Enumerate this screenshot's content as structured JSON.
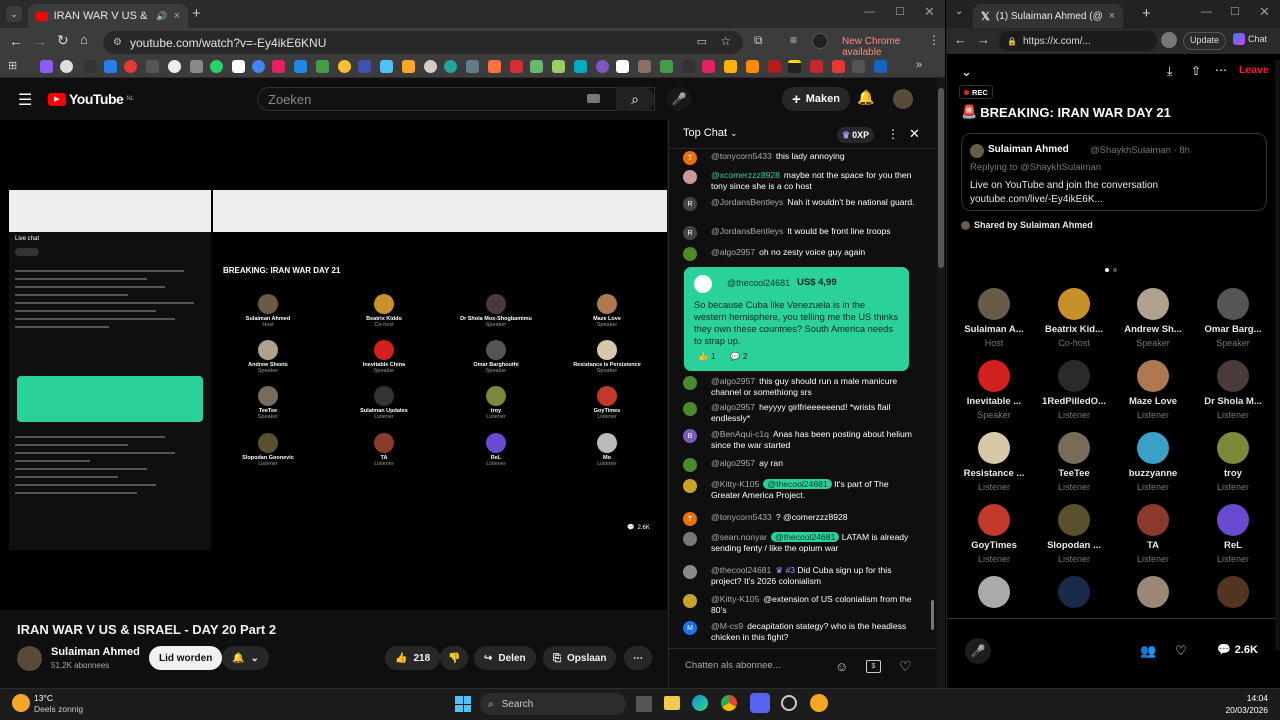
{
  "left_browser": {
    "tab_title": "IRAN WAR V US & ISRAEL",
    "url": "youtube.com/watch?v=-Ey4ikE6KNU",
    "update_label": "New Chrome available"
  },
  "youtube": {
    "logo_text": "YouTube",
    "logo_region": "NL",
    "search_placeholder": "Zoeken",
    "create_label": "Maken",
    "video_title": "IRAN WAR V US & ISRAEL - DAY 20 Part 2",
    "channel_name": "Sulaiman Ahmed",
    "subscribers": "51,2K abonnees",
    "join_label": "Lid worden",
    "likes": "218",
    "share_label": "Delen",
    "save_label": "Opslaan"
  },
  "chat": {
    "title": "Top Chat",
    "xp": "0XP",
    "input_placeholder": "Chatten als abonnee...",
    "messages": [
      {
        "user": "@tonycorn5433",
        "text": "this lady annoying",
        "initial": "T",
        "color": "#e8710a"
      },
      {
        "user": "@xcomerzzz8928",
        "text": "maybe not the space for you then tony since she is a co host",
        "initial": "",
        "color": "#c99",
        "highlight": true
      },
      {
        "user": "@JordansBentleys",
        "text": "Nah it wouldn't be national guard.",
        "initial": "R",
        "color": "#444"
      },
      {
        "user": "@JordansBentleys",
        "text": "It would be front line troops",
        "initial": "R",
        "color": "#444"
      },
      {
        "user": "@algo2957",
        "text": "oh no zesty voice guy again",
        "initial": "",
        "color": "#4a8a2a"
      }
    ],
    "superchat": {
      "user": "@thecool24681",
      "amount": "US$ 4,99",
      "text": "So because Cuba like Venezuela is in the western hemisphere, you telling me the US thinks they own these countries? South America needs to strap up.",
      "likes": "1",
      "replies": "2"
    },
    "messages2": [
      {
        "user": "@algo2957",
        "text": "this guy should run a male manicure channel or somethiong srs",
        "initial": "",
        "color": "#4a8a2a"
      },
      {
        "user": "@algo2957",
        "text": "heyyyy girlfrieeeeeend! *wrists flail endlessly*",
        "initial": "",
        "color": "#4a8a2a"
      },
      {
        "user": "@BenAqui-c1q",
        "text": "Anas has been posting about helium since the war started",
        "initial": "B",
        "color": "#7e57c2"
      },
      {
        "user": "@algo2957",
        "text": "ay ran",
        "initial": "",
        "color": "#4a8a2a"
      },
      {
        "user": "@Kitty-K105",
        "text": "It's part of The Greater America Project.",
        "initial": "",
        "color": "#c9a227",
        "mention": "@thecool24681"
      },
      {
        "user": "@tonycorn5433",
        "text": "? @comerzzz8928",
        "initial": "T",
        "color": "#e8710a"
      },
      {
        "user": "@sean.nonyar",
        "text": "LATAM is already sending fenty / like the opium war",
        "initial": "",
        "color": "#777",
        "mention": "@thecool24681"
      },
      {
        "user": "@thecool24681",
        "text": "Did Cuba sign up for this project? It's 2026 colonialism",
        "initial": "",
        "color": "#888",
        "rank": "#3"
      },
      {
        "user": "@Kitty-K105",
        "text": "@extension of US colonialism from the 80's",
        "initial": "",
        "color": "#c9a227"
      },
      {
        "user": "@M-cs9",
        "text": "decapitation stategy? who is the headless chicken in this fight?",
        "initial": "M",
        "color": "#1a73e8"
      }
    ]
  },
  "video_space": {
    "title": "BREAKING: IRAN WAR DAY 21",
    "live_chat_label": "Live chat",
    "listener_count": "2.6K",
    "nodes": [
      {
        "name": "Sulaiman Ahmed",
        "role": "Host"
      },
      {
        "name": "Beatrix Kiddo",
        "role": "Co-host"
      },
      {
        "name": "Dr Shola Mos-Shogbamimu",
        "role": "Speaker"
      },
      {
        "name": "Maze Love",
        "role": "Speaker"
      },
      {
        "name": "Andrew Sheets",
        "role": "Speaker"
      },
      {
        "name": "Inevitable China",
        "role": "Speaker"
      },
      {
        "name": "Omar Barghouthi",
        "role": "Speaker"
      },
      {
        "name": "Resistance is Persistence",
        "role": "Speaker"
      },
      {
        "name": "TeeTee",
        "role": "Speaker"
      },
      {
        "name": "Sulaiman Updates",
        "role": "Listener"
      },
      {
        "name": "troy",
        "role": "Listener"
      },
      {
        "name": "GoyTimes",
        "role": "Listener"
      },
      {
        "name": "Slopodan Goonevic",
        "role": "Listener"
      },
      {
        "name": "TA",
        "role": "Listener"
      },
      {
        "name": "ReL",
        "role": "Listener"
      },
      {
        "name": "Mo",
        "role": "Listener"
      }
    ]
  },
  "right_browser": {
    "tab_title": "(1) Sulaiman Ahmed (@ShaykhSul",
    "url": "https://x.com/...",
    "update_label": "Update",
    "chat_label": "Chat",
    "leave_label": "Leave",
    "rec_label": "REC",
    "space_title": "BREAKING: IRAN WAR DAY 21",
    "post_author": "Sulaiman Ahmed",
    "post_handle": "@ShaykhSulaiman · 8h",
    "replying_to": "Replying to @ShaykhSulaiman",
    "post_text_1": "Live on YouTube and join the conversation",
    "post_text_2": "youtube.com/live/-Ey4ikE6K...",
    "shared_by": "Shared by Sulaiman Ahmed",
    "listener_count": "2.6K",
    "speakers": [
      {
        "name": "Sulaiman A...",
        "role": "Host",
        "color": "#6a5a4a"
      },
      {
        "name": "Beatrix Kid...",
        "role": "Co-host",
        "color": "#c8902a"
      },
      {
        "name": "Andrew Sh...",
        "role": "Speaker",
        "color": "#b0a090"
      },
      {
        "name": "Omar Barg...",
        "role": "Speaker",
        "color": "#555"
      },
      {
        "name": "Inevitable ...",
        "role": "Speaker",
        "color": "#d21f1f"
      },
      {
        "name": "1RedPilledO...",
        "role": "Listener",
        "color": "#2a2a2a"
      },
      {
        "name": "Maze Love",
        "role": "Listener",
        "color": "#b07850"
      },
      {
        "name": "Dr Shola M...",
        "role": "Listener",
        "color": "#4a3a3a"
      },
      {
        "name": "Resistance ...",
        "role": "Listener",
        "color": "#d7c6a8"
      },
      {
        "name": "TeeTee",
        "role": "Listener",
        "color": "#7a6a5a"
      },
      {
        "name": "buzzyanne",
        "role": "Listener",
        "color": "#3aa0c8"
      },
      {
        "name": "troy",
        "role": "Listener",
        "color": "#7a8a3a"
      },
      {
        "name": "GoyTimes",
        "role": "Listener",
        "color": "#c0392b"
      },
      {
        "name": "Slopodan ...",
        "role": "Listener",
        "color": "#5a5030"
      },
      {
        "name": "TA",
        "role": "Listener",
        "color": "#8a3a2a"
      },
      {
        "name": "ReL",
        "role": "Listener",
        "color": "#6a4ad0"
      },
      {
        "name": "",
        "role": "",
        "color": "#aaa"
      },
      {
        "name": "",
        "role": "",
        "color": "#1a2a4a"
      },
      {
        "name": "",
        "role": "",
        "color": "#998877"
      },
      {
        "name": "",
        "role": "",
        "color": "#553322"
      }
    ]
  },
  "taskbar": {
    "temperature": "13°C",
    "weather": "Deels zonnig",
    "search": "Search",
    "time": "14:04",
    "date": "20/03/2026"
  }
}
